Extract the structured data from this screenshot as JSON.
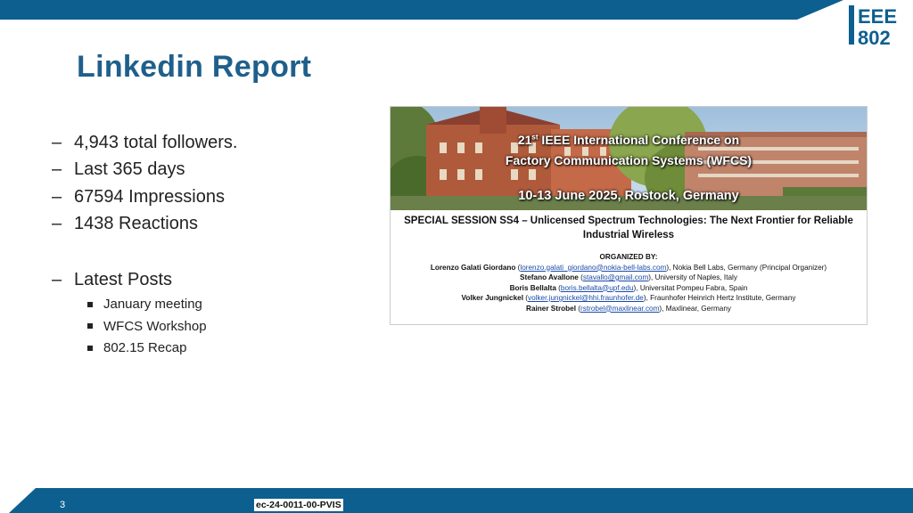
{
  "logo_text": "IEEE 802",
  "title": "Linkedin Report",
  "stats": [
    "4,943 total followers.",
    "Last 365 days",
    "67594 Impressions",
    "1438 Reactions"
  ],
  "latest_label": "Latest Posts",
  "posts": [
    "January meeting",
    "WFCS Workshop",
    "802.15 Recap"
  ],
  "flyer": {
    "conf_line1_pre": "21",
    "conf_line1_sup": "st",
    "conf_line1_post": " IEEE International Conference on",
    "conf_line2": "Factory Communication Systems (WFCS)",
    "conf_line3": "10-13 June 2025, Rostock, Germany",
    "session_line1": "SPECIAL SESSION SS4 – Unlicensed Spectrum Technologies: The Next Frontier for Reliable",
    "session_line2": "Industrial Wireless",
    "organized_by": "ORGANIZED BY:",
    "organizers": [
      {
        "name": "Lorenzo Galati Giordano",
        "email": "lorenzo.galati_giordano@nokia-bell-labs.com",
        "affil": ", Nokia Bell Labs, Germany (Principal Organizer)"
      },
      {
        "name": "Stefano Avallone",
        "email": "stavallo@gmail.com",
        "affil": ", University of Naples, Italy"
      },
      {
        "name": "Boris Bellalta",
        "email": "boris.bellalta@upf.edu",
        "affil": ", Universitat Pompeu Fabra, Spain"
      },
      {
        "name": "Volker Jungnickel",
        "email": "volker.jungnickel@hhi.fraunhofer.de",
        "affil": ", Fraunhofer Heinrich Hertz Institute, Germany"
      },
      {
        "name": "Rainer Strobel",
        "email": "rstrobel@maxlinear.com",
        "affil": ", Maxlinear, Germany"
      }
    ]
  },
  "page_number": "3",
  "doc_id": "ec-24-0011-00-PVIS",
  "colors": {
    "brand_blue": "#0d5f8f",
    "title_blue": "#1f5f8b"
  }
}
